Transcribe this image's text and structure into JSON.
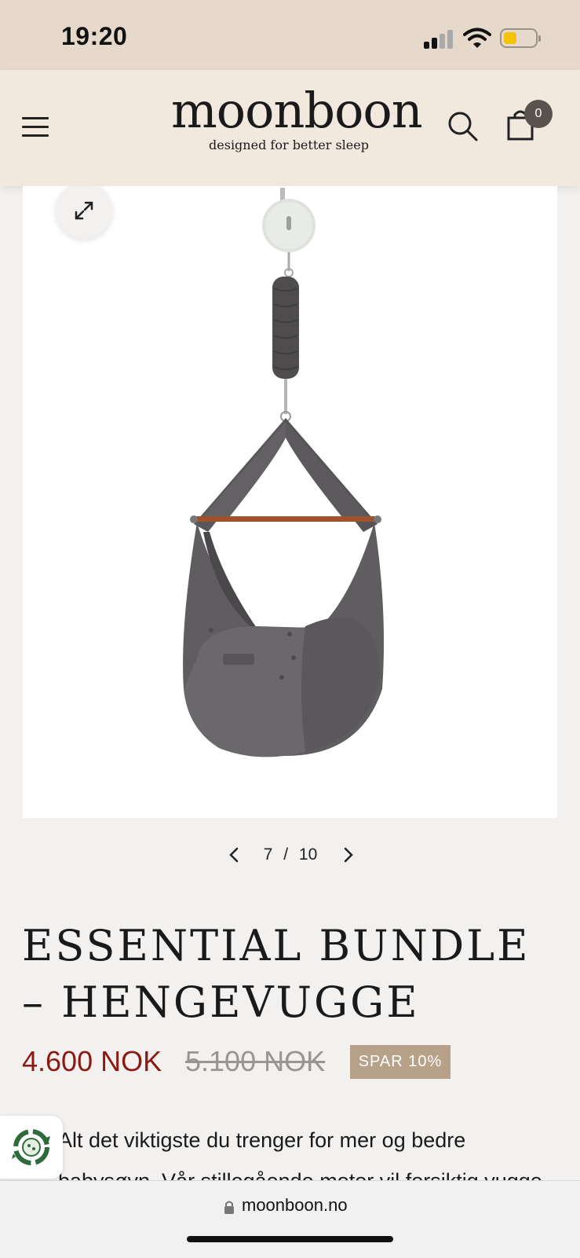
{
  "status_bar": {
    "time": "19:20"
  },
  "header": {
    "logo_name": "moonboon",
    "logo_tagline": "designed for better sleep",
    "cart_count": "0"
  },
  "gallery": {
    "current": "7",
    "separator": "/",
    "total": "10"
  },
  "product": {
    "title": "ESSENTIAL BUNDLE – HENGEVUGGE",
    "price": "4.600 NOK",
    "old_price": "5.100 NOK",
    "save_badge": "SPAR 10%",
    "description": "Alt det viktigste du trenger for mer og bedre babysøvn. Vår stillegående motor vil forsiktig vugge"
  },
  "browser": {
    "url": "moonboon.no"
  },
  "colors": {
    "header_bg": "#f1e8de",
    "status_bg": "#e6d8ca",
    "price_red": "#8b1a14",
    "badge_tan": "#b7a189"
  }
}
